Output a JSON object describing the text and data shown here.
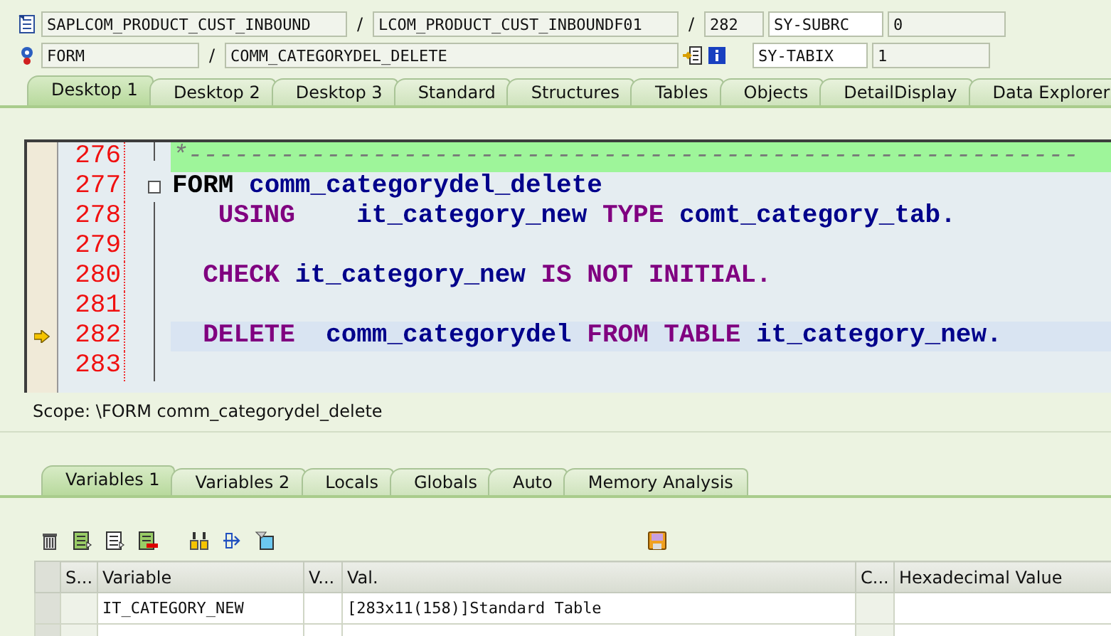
{
  "header": {
    "row_1": {
      "program": "SAPLCOM_PRODUCT_CUST_INBOUND",
      "separator_1": "/",
      "include": "LCOM_PRODUCT_CUST_INBOUNDF01",
      "separator_2": "/",
      "line": "282",
      "sys_field": "SY-SUBRC",
      "sys_value": "0"
    },
    "row_2": {
      "event_type": "FORM",
      "separator": "/",
      "event": "COMM_CATEGORYDEL_DELETE",
      "sys_field": "SY-TABIX",
      "sys_value": "1"
    }
  },
  "desktop_tabs": [
    {
      "label": "Desktop 1",
      "selected": true
    },
    {
      "label": "Desktop 2",
      "selected": false
    },
    {
      "label": "Desktop 3",
      "selected": false
    },
    {
      "label": "Standard",
      "selected": false
    },
    {
      "label": "Structures",
      "selected": false
    },
    {
      "label": "Tables",
      "selected": false
    },
    {
      "label": "Objects",
      "selected": false
    },
    {
      "label": "DetailDisplay",
      "selected": false
    },
    {
      "label": "Data Explorer",
      "selected": false
    }
  ],
  "editor": {
    "lines": [
      {
        "number": "276",
        "kind": "comment",
        "current": false,
        "fold": false,
        "tokens": [
          {
            "text": "*----------------------------------------------------------",
            "kind": "comment"
          }
        ]
      },
      {
        "number": "277",
        "kind": "code",
        "current": false,
        "fold": true,
        "tokens": [
          {
            "text": "FORM",
            "kind": "definition"
          },
          {
            "text": " comm_categorydel_delete",
            "kind": "name"
          }
        ]
      },
      {
        "number": "278",
        "kind": "code",
        "current": false,
        "fold": false,
        "tokens": [
          {
            "text": "   USING",
            "kind": "keyword"
          },
          {
            "text": "    it_category_new",
            "kind": "name"
          },
          {
            "text": " TYPE",
            "kind": "keyword"
          },
          {
            "text": " comt_category_tab.",
            "kind": "name"
          }
        ]
      },
      {
        "number": "279",
        "kind": "code",
        "current": false,
        "fold": false
      },
      {
        "number": "280",
        "kind": "code",
        "current": false,
        "fold": false,
        "tokens": [
          {
            "text": "  CHECK",
            "kind": "keyword"
          },
          {
            "text": " it_category_new",
            "kind": "name"
          },
          {
            "text": " IS NOT INITIAL.",
            "kind": "keyword"
          }
        ]
      },
      {
        "number": "281",
        "kind": "code",
        "current": false,
        "fold": false
      },
      {
        "number": "282",
        "kind": "code",
        "current": true,
        "fold": false,
        "tokens": [
          {
            "text": "  DELETE",
            "kind": "keyword"
          },
          {
            "text": "  comm_categorydel",
            "kind": "name"
          },
          {
            "text": " FROM TABLE",
            "kind": "keyword"
          },
          {
            "text": " it_category_new.",
            "kind": "name"
          }
        ]
      },
      {
        "number": "283",
        "kind": "code",
        "current": false,
        "fold": false
      }
    ]
  },
  "scope": "Scope: \\FORM comm_categorydel_delete",
  "variable_tabs": [
    {
      "label": "Variables 1",
      "selected": true
    },
    {
      "label": "Variables 2",
      "selected": false
    },
    {
      "label": "Locals",
      "selected": false
    },
    {
      "label": "Globals",
      "selected": false
    },
    {
      "label": "Auto",
      "selected": false
    },
    {
      "label": "Memory Analysis",
      "selected": false
    }
  ],
  "table": {
    "columns": [
      "S...",
      "Variable",
      "V...",
      "Val.",
      "C...",
      "Hexadecimal Value"
    ],
    "rows": [
      {
        "cells": [
          "",
          "IT_CATEGORY_NEW",
          "",
          "[283x11(158)]Standard Table",
          "",
          ""
        ]
      },
      {
        "cells": [
          "",
          "",
          "",
          "",
          "",
          ""
        ]
      }
    ]
  }
}
